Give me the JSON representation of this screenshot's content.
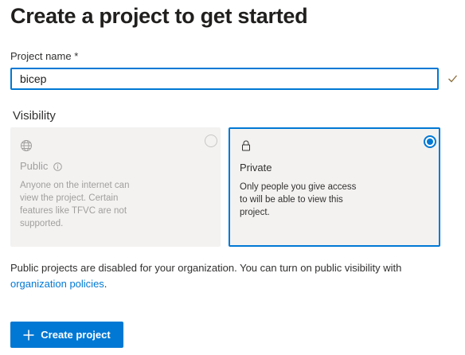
{
  "page": {
    "title": "Create a project to get started"
  },
  "project_name": {
    "label": "Project name *",
    "value": "bicep",
    "valid": true
  },
  "visibility": {
    "label": "Visibility",
    "selected": "private",
    "options": [
      {
        "id": "public",
        "title": "Public",
        "icon": "globe-icon",
        "description": "Anyone on the internet can view the project. Certain features like TFVC are not supported.",
        "disabled": true
      },
      {
        "id": "private",
        "title": "Private",
        "icon": "lock-icon",
        "description": "Only people you give access to will be able to view this project.",
        "disabled": false
      }
    ]
  },
  "notice": {
    "text": "Public projects are disabled for your organization. You can turn on public visibility with ",
    "link_text": "organization policies",
    "suffix": "."
  },
  "actions": {
    "create_label": "Create project"
  },
  "colors": {
    "accent": "#0078d4",
    "valid_check": "#8a6d3b",
    "card_bg": "#f3f2f1",
    "disabled_text": "#a19f9d"
  }
}
